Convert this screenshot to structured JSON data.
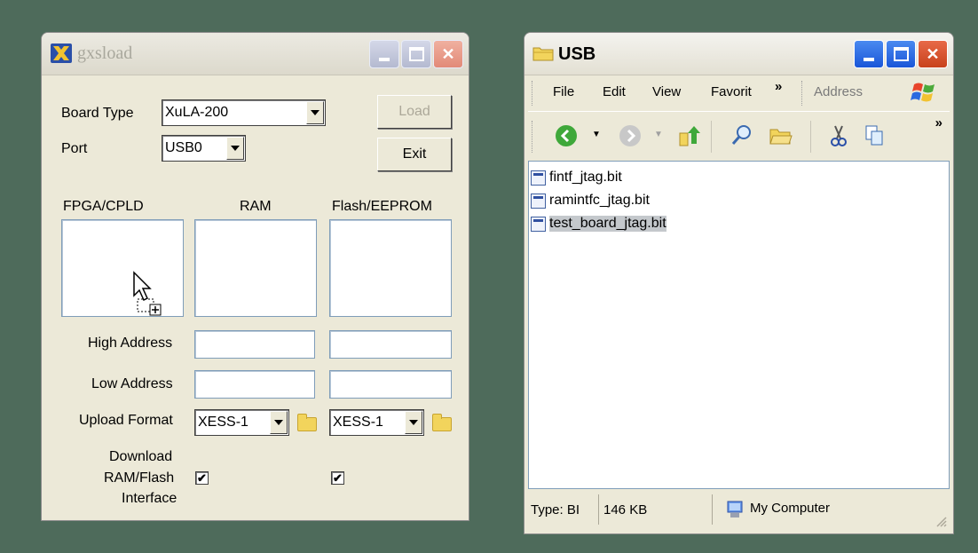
{
  "gxsload": {
    "title": "gxsload",
    "board_type_label": "Board Type",
    "board_type_value": "XuLA-200",
    "port_label": "Port",
    "port_value": "USB0",
    "load_label": "Load",
    "exit_label": "Exit",
    "col_fpga": "FPGA/CPLD",
    "col_ram": "RAM",
    "col_flash": "Flash/EEPROM",
    "high_address_label": "High Address",
    "low_address_label": "Low Address",
    "upload_format_label": "Upload Format",
    "ram_format_value": "XESS-1",
    "flash_format_value": "XESS-1",
    "download_label_1": "Download",
    "download_label_2": "RAM/Flash",
    "download_label_3": "Interface",
    "ram_check": "✔",
    "flash_check": "✔"
  },
  "explorer": {
    "title": "USB",
    "menu": [
      "File",
      "Edit",
      "View",
      "Favorit"
    ],
    "menu_more": "»",
    "address_label": "Address",
    "toolbar_more": "»",
    "files": [
      "fintf_jtag.bit",
      "ramintfc_jtag.bit",
      "test_board_jtag.bit"
    ],
    "status_type": "Type: BI",
    "status_size": "146 KB",
    "status_location": "My Computer"
  },
  "colors": {
    "desktop": "#4e6b5b",
    "window_face": "#ece9d8",
    "selection": "#c4c8cc"
  }
}
